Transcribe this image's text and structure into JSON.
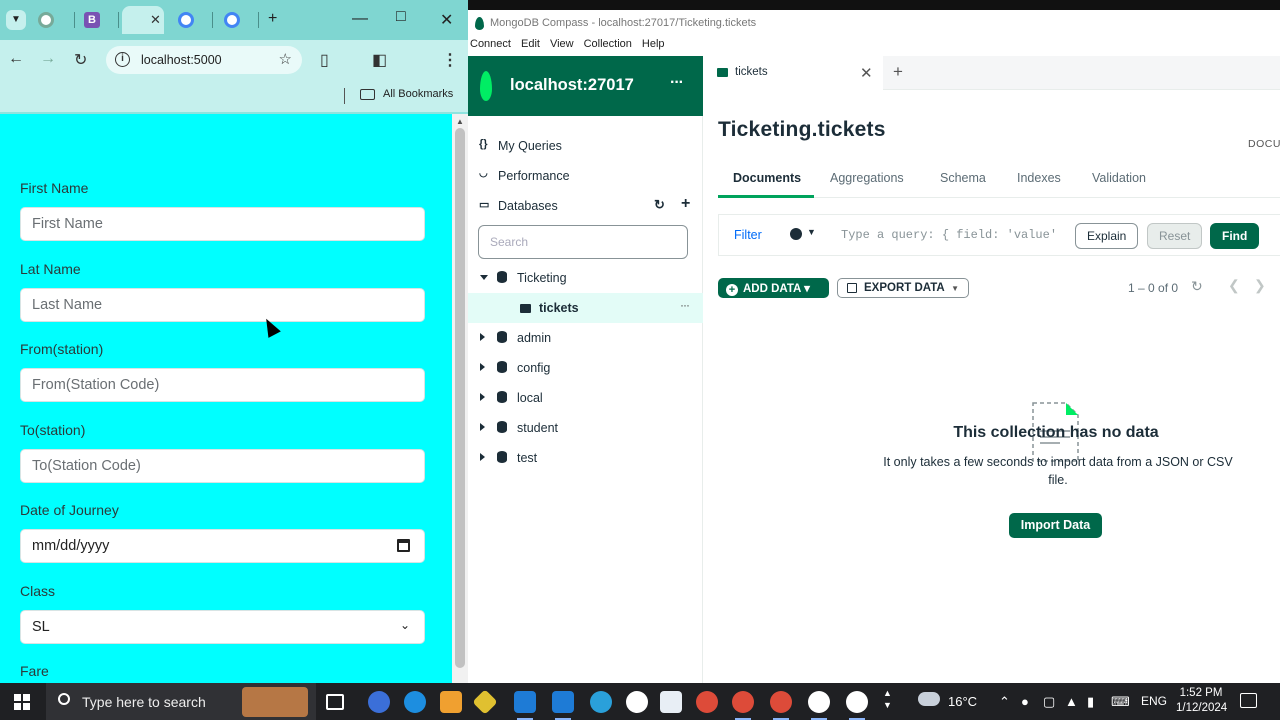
{
  "browser": {
    "address": "localhost:5000",
    "bookmarks_label": "All Bookmarks"
  },
  "form": {
    "fields": [
      {
        "label": "First Name",
        "placeholder": "First Name"
      },
      {
        "label": "Lat Name",
        "placeholder": "Last Name"
      },
      {
        "label": "From(station)",
        "placeholder": "From(Station Code)"
      },
      {
        "label": "To(station)",
        "placeholder": "To(Station Code)"
      },
      {
        "label": "Date of Journey",
        "value": "mm/dd/yyyy"
      },
      {
        "label": "Class",
        "value": "SL"
      },
      {
        "label": "Fare"
      }
    ]
  },
  "compass": {
    "window_title": "MongoDB Compass - localhost:27017/Ticketing.tickets",
    "menu": [
      "Connect",
      "Edit",
      "View",
      "Collection",
      "Help"
    ],
    "connection": "localhost:27017",
    "nav": {
      "queries": "My Queries",
      "performance": "Performance",
      "databases": "Databases"
    },
    "search_placeholder": "Search",
    "databases": [
      "Ticketing",
      "admin",
      "config",
      "local",
      "student",
      "test"
    ],
    "active_collection": "tickets",
    "tab_label": "tickets",
    "namespace": "Ticketing.tickets",
    "doc_label": "DOCU",
    "subtabs": [
      "Documents",
      "Aggregations",
      "Schema",
      "Indexes",
      "Validation"
    ],
    "filter_label": "Filter",
    "query_placeholder": "Type a query: { field: 'value'",
    "buttons": {
      "explain": "Explain",
      "reset": "Reset",
      "find": "Find"
    },
    "add_data": "ADD DATA",
    "export_data": "EXPORT DATA",
    "count": "1 – 0 of 0",
    "empty_title": "This collection has no data",
    "empty_desc": "It only takes a few seconds to import data from a JSON or CSV file.",
    "import_label": "Import Data",
    "accent": "#00684a"
  },
  "taskbar": {
    "search_text": "Type here to search",
    "temperature": "16°C",
    "language": "ENG",
    "time": "1:52 PM",
    "date": "1/12/2024"
  }
}
